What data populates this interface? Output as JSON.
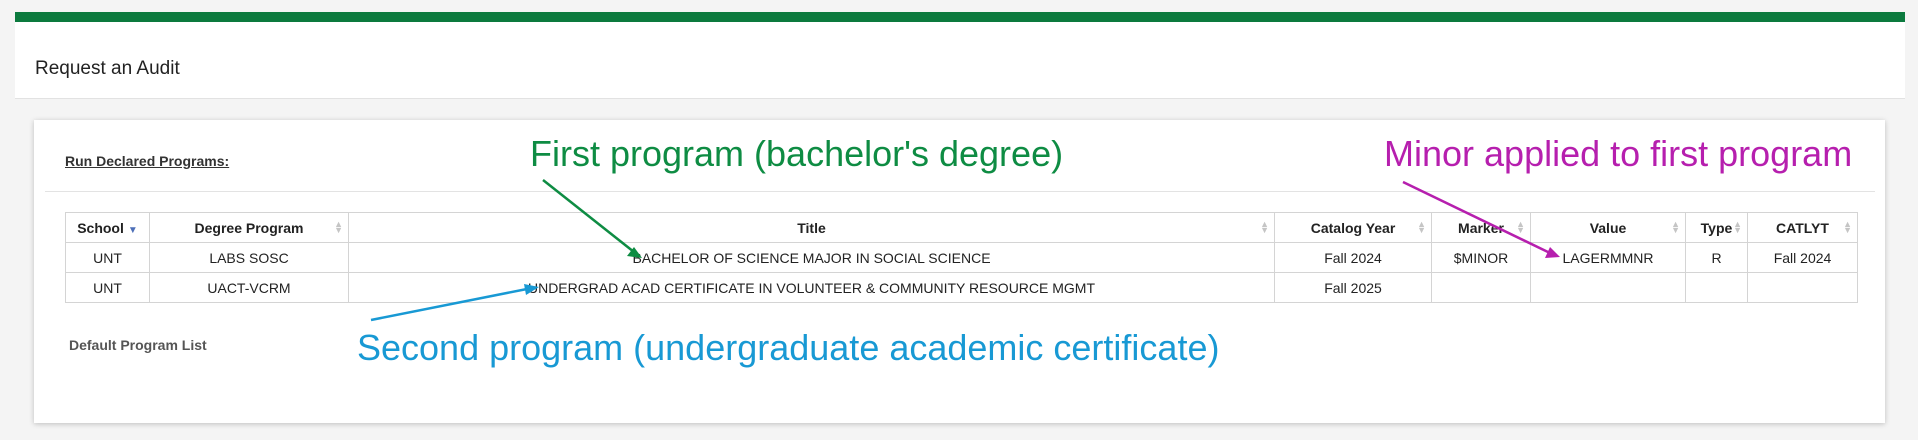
{
  "page": {
    "title": "Request an Audit"
  },
  "section": {
    "run_label": "Run Declared Programs:",
    "default_list_label": "Default Program List"
  },
  "table": {
    "headers": [
      "School",
      "Degree Program",
      "Title",
      "Catalog Year",
      "Marker",
      "Value",
      "Type",
      "CATLYT"
    ],
    "rows": [
      [
        "UNT",
        "LABS SOSC",
        "BACHELOR OF SCIENCE MAJOR IN SOCIAL SCIENCE",
        "Fall 2024",
        "$MINOR",
        "LAGERMMNR",
        "R",
        "Fall 2024"
      ],
      [
        "UNT",
        "UACT-VCRM",
        "UNDERGRAD ACAD CERTIFICATE IN VOLUNTEER & COMMUNITY RESOURCE MGMT",
        "Fall 2025",
        "",
        "",
        "",
        ""
      ]
    ]
  },
  "annotations": {
    "first": "First program (bachelor's degree)",
    "minor": "Minor applied to first program",
    "second": "Second program (undergraduate academic certificate)"
  },
  "colors": {
    "header_bar": "#0c7a3e",
    "annotation_green": "#0e8c43",
    "annotation_magenta": "#b61fae",
    "annotation_blue": "#1899d4"
  }
}
